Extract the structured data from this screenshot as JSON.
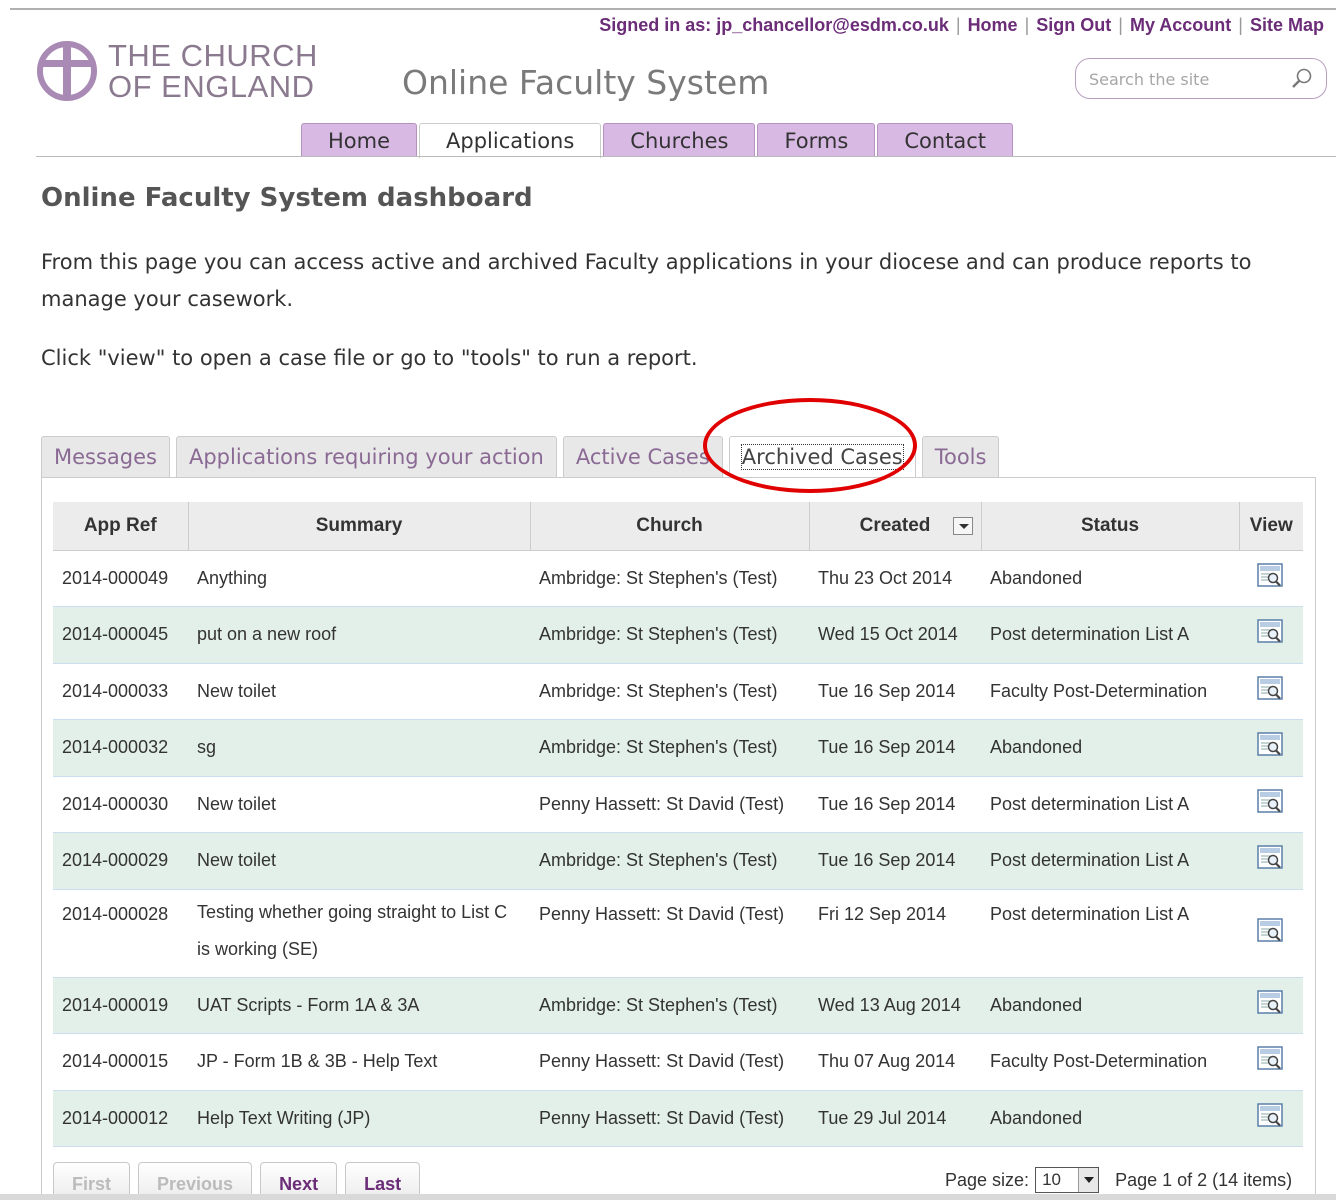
{
  "header": {
    "signed_in_label": "Signed in as: jp_chancellor@esdm.co.uk",
    "links": [
      "Home",
      "Sign Out",
      "My Account",
      "Site Map"
    ],
    "logo_line1": "THE CHURCH",
    "logo_line2": "OF ENGLAND",
    "site_title": "Online Faculty System",
    "search_placeholder": "Search the site"
  },
  "nav": {
    "tabs": [
      "Home",
      "Applications",
      "Churches",
      "Forms",
      "Contact"
    ],
    "active": "Applications"
  },
  "page": {
    "title": "Online Faculty System dashboard",
    "intro": "From this page you can access active and archived Faculty applications in your diocese and can produce reports to manage your casework.",
    "instructions": "Click \"view\" to open a case file or go to \"tools\" to run a report."
  },
  "subtabs": [
    "Messages",
    "Applications requiring your action",
    "Active Cases",
    "Archived Cases",
    "Tools"
  ],
  "table": {
    "columns": [
      "App Ref",
      "Summary",
      "Church",
      "Created",
      "Status",
      "View"
    ],
    "rows": [
      {
        "ref": "2014-000049",
        "summary": "Anything",
        "church": "Ambridge: St Stephen's (Test)",
        "created": "Thu 23 Oct 2014",
        "status": "Abandoned"
      },
      {
        "ref": "2014-000045",
        "summary": "put on a new roof",
        "church": "Ambridge: St Stephen's (Test)",
        "created": "Wed 15 Oct 2014",
        "status": "Post determination List A"
      },
      {
        "ref": "2014-000033",
        "summary": "New toilet",
        "church": "Ambridge: St Stephen's (Test)",
        "created": "Tue 16 Sep 2014",
        "status": "Faculty Post-Determination"
      },
      {
        "ref": "2014-000032",
        "summary": "sg",
        "church": "Ambridge: St Stephen's (Test)",
        "created": "Tue 16 Sep 2014",
        "status": "Abandoned"
      },
      {
        "ref": "2014-000030",
        "summary": "New toilet",
        "church": "Penny Hassett: St David (Test)",
        "created": "Tue 16 Sep 2014",
        "status": "Post determination List A"
      },
      {
        "ref": "2014-000029",
        "summary": "New toilet",
        "church": "Ambridge: St Stephen's (Test)",
        "created": "Tue 16 Sep 2014",
        "status": "Post determination List A"
      },
      {
        "ref": "2014-000028",
        "summary": "Testing whether going straight to List C is working (SE)",
        "church": "Penny Hassett: St David (Test)",
        "created": "Fri 12 Sep 2014",
        "status": "Post determination List A"
      },
      {
        "ref": "2014-000019",
        "summary": "UAT Scripts - Form 1A & 3A",
        "church": "Ambridge: St Stephen's (Test)",
        "created": "Wed 13 Aug 2014",
        "status": "Abandoned"
      },
      {
        "ref": "2014-000015",
        "summary": "JP - Form 1B & 3B - Help Text",
        "church": "Penny Hassett: St David (Test)",
        "created": "Thu 07 Aug 2014",
        "status": "Faculty Post-Determination"
      },
      {
        "ref": "2014-000012",
        "summary": "Help Text Writing (JP)",
        "church": "Penny Hassett: St David (Test)",
        "created": "Tue 29 Jul 2014",
        "status": "Abandoned"
      }
    ]
  },
  "pager": {
    "buttons": [
      "First",
      "Previous",
      "Next",
      "Last"
    ],
    "page_size_label": "Page size:",
    "page_size": "10",
    "page_info": "Page 1 of 2 (14 items)"
  },
  "colors": {
    "brand_purple": "#6b2c78",
    "nav_tab": "#d8b9e4",
    "row_alt": "#e3f0ea",
    "highlight_circle": "#e00000"
  }
}
